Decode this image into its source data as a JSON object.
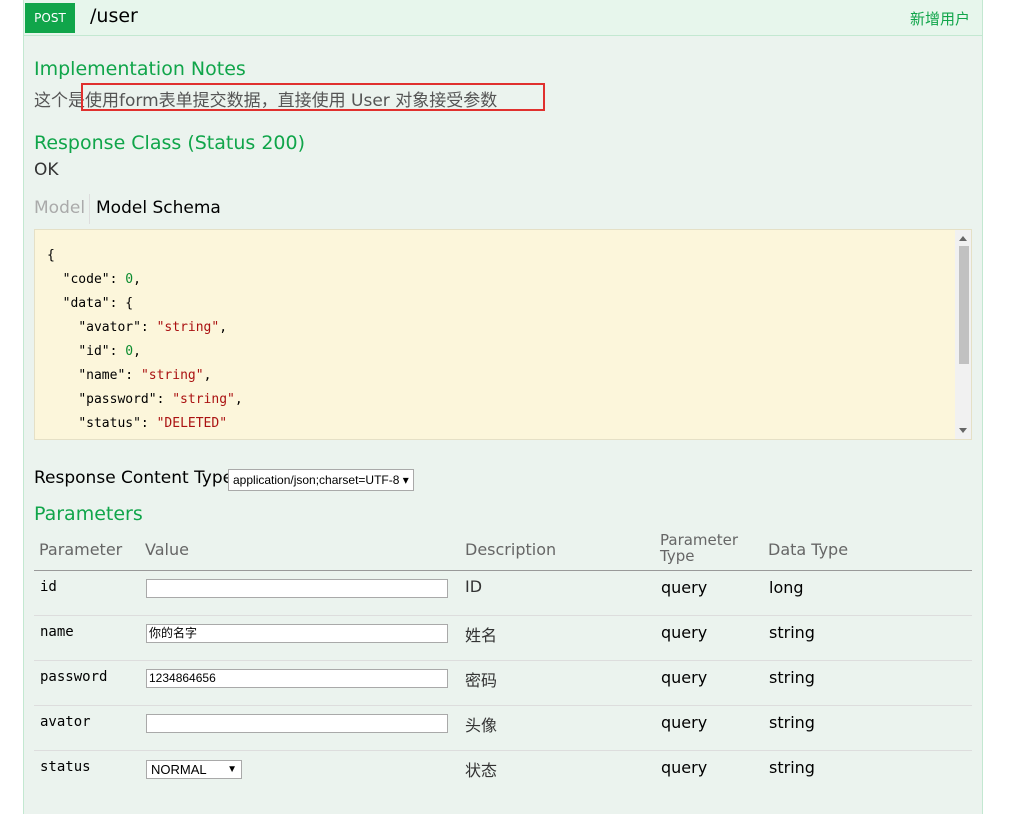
{
  "operation": {
    "method": "POST",
    "path": "/user",
    "summary": "新增用户"
  },
  "implementation_notes": {
    "title": "Implementation Notes",
    "text": "这个是使用form表单提交数据，直接使用 User 对象接受参数"
  },
  "response_class": {
    "title": "Response Class (Status 200)",
    "status_text": "OK"
  },
  "model_tabs": {
    "model": "Model",
    "schema": "Model Schema"
  },
  "schema_lines": [
    {
      "indent": 0,
      "key": "",
      "value": "{",
      "vtype": "k"
    },
    {
      "indent": 1,
      "key": "\"code\": ",
      "value": "0",
      "vtype": "n",
      "suffix": ","
    },
    {
      "indent": 1,
      "key": "\"data\": ",
      "value": "{",
      "vtype": "k"
    },
    {
      "indent": 2,
      "key": "\"avator\": ",
      "value": "\"string\"",
      "vtype": "s",
      "suffix": ","
    },
    {
      "indent": 2,
      "key": "\"id\": ",
      "value": "0",
      "vtype": "n",
      "suffix": ","
    },
    {
      "indent": 2,
      "key": "\"name\": ",
      "value": "\"string\"",
      "vtype": "s",
      "suffix": ","
    },
    {
      "indent": 2,
      "key": "\"password\": ",
      "value": "\"string\"",
      "vtype": "s",
      "suffix": ","
    },
    {
      "indent": 2,
      "key": "\"status\": ",
      "value": "\"DELETED\"",
      "vtype": "s"
    }
  ],
  "response_content_type": {
    "label": "Response Content Type",
    "selected": "application/json;charset=UTF-8 ▾"
  },
  "parameters": {
    "title": "Parameters",
    "headers": {
      "parameter": "Parameter",
      "value": "Value",
      "description": "Description",
      "parameter_type_1": "Parameter",
      "parameter_type_2": "Type",
      "data_type": "Data Type"
    },
    "rows": [
      {
        "name": "id",
        "value": "",
        "description": "ID",
        "param_type": "query",
        "data_type": "long"
      },
      {
        "name": "name",
        "value": "你的名字",
        "description": "姓名",
        "param_type": "query",
        "data_type": "string"
      },
      {
        "name": "password",
        "value": "1234864656",
        "description": "密码",
        "param_type": "query",
        "data_type": "string"
      },
      {
        "name": "avator",
        "value": "",
        "description": "头像",
        "param_type": "query",
        "data_type": "string"
      },
      {
        "name": "status",
        "value": "NORMAL",
        "description": "状态",
        "param_type": "query",
        "data_type": "string"
      }
    ]
  },
  "colors": {
    "accent_green": "#10a54a",
    "panel_bg": "#ebf3ee",
    "schema_bg": "#fcf6db",
    "highlight_red": "#e0302e"
  }
}
